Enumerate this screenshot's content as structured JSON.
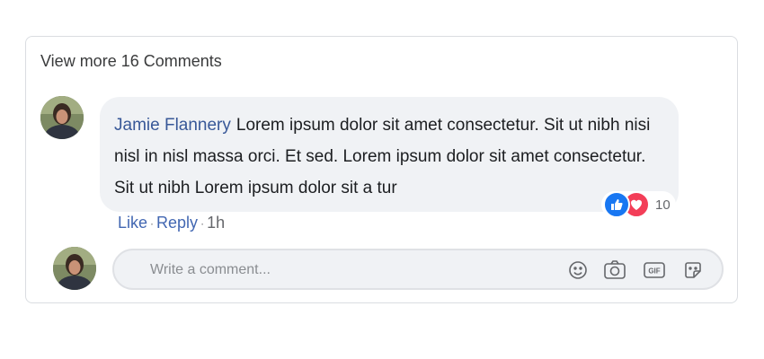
{
  "header": {
    "view_more": "View more 16 Comments"
  },
  "comment": {
    "author": "Jamie Flannery",
    "text": "Lorem ipsum dolor sit amet consectetur. Sit ut nibh nisi nisl in nisl massa orci. Et sed. Lorem ipsum dolor sit amet consectetur. Sit ut nibh Lorem ipsum dolor sit a tur",
    "reactions": {
      "count": "10",
      "icons": [
        "like-icon",
        "love-icon"
      ]
    },
    "actions": {
      "like": "Like",
      "reply": "Reply",
      "sep": "·",
      "time": "1h"
    }
  },
  "composer": {
    "placeholder": "Write a comment...",
    "tools": [
      "emoji-icon",
      "camera-icon",
      "gif-icon",
      "sticker-icon"
    ]
  },
  "colors": {
    "link": "#4267b2",
    "author": "#385898",
    "like": "#1877f2",
    "love": "#f33e58"
  }
}
